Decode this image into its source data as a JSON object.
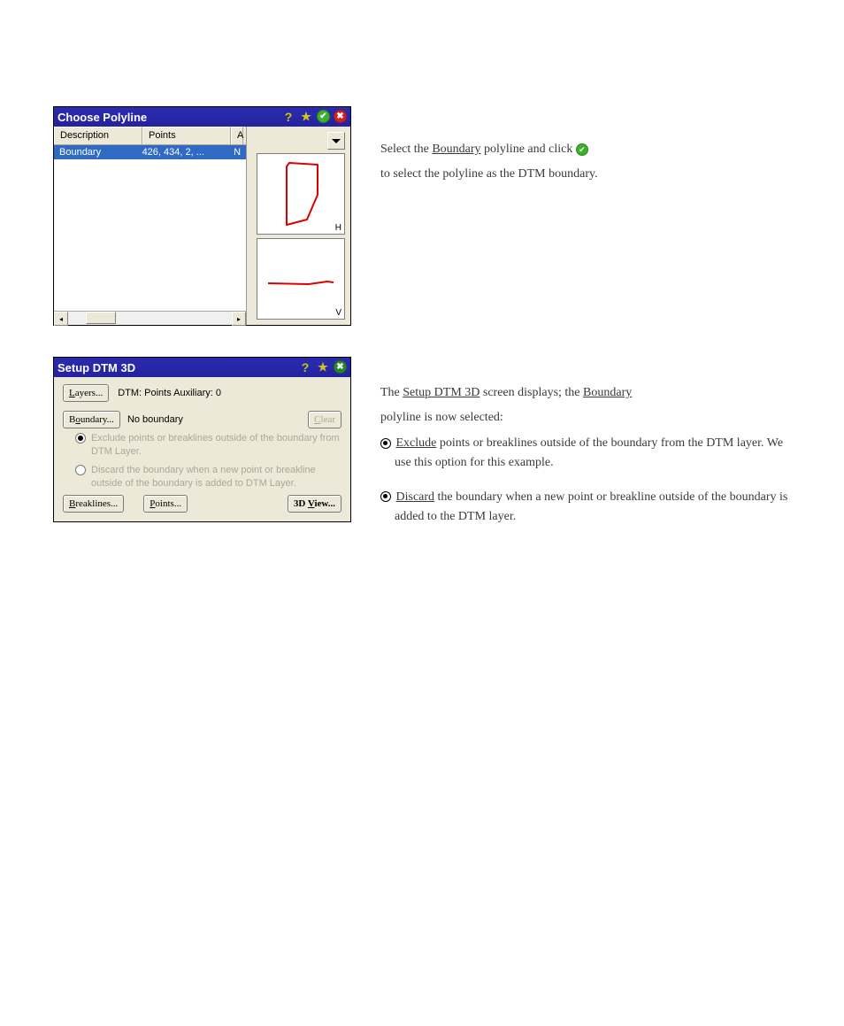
{
  "choose_polyline": {
    "title": "Choose Polyline",
    "headers": {
      "description": "Description",
      "points": "Points",
      "a": "A"
    },
    "row": {
      "description": "Boundary",
      "points": "426, 434, 2, ...",
      "a": "N"
    },
    "h_label": "H",
    "v_label": "V"
  },
  "setup_dtm": {
    "title": "Setup DTM 3D",
    "layers_btn": "Layers...",
    "dtm_label": "DTM: Points Auxiliary: 0",
    "boundary_btn": "Boundary...",
    "boundary_label": "No boundary",
    "clear_btn": "Clear",
    "radio1": "Exclude points or breaklines outside of the boundary from DTM Layer.",
    "radio2": "Discard the boundary when a new point or breakline outside of the boundary is added to DTM Layer.",
    "breaklines_btn": "Breaklines...",
    "points_btn": "Points...",
    "view3d_btn": "3D View..."
  },
  "side1": {
    "a": "Select the ",
    "b": "Boundary",
    "c": " polyline and click ",
    "d": " to select the polyline as the DTM boundary."
  },
  "side2": {
    "a": "The ",
    "b": "Setup DTM 3D",
    "c": " screen displays; the ",
    "d": "Boundary",
    "e": " polyline is now selected:",
    "opt1a": "Exclude",
    "opt1b": " points or breaklines outside of the boundary from the DTM layer. We use this option for this example.",
    "opt2a": "Discard",
    "opt2b": " the boundary when a new point or breakline outside of the boundary is added to the DTM layer."
  }
}
